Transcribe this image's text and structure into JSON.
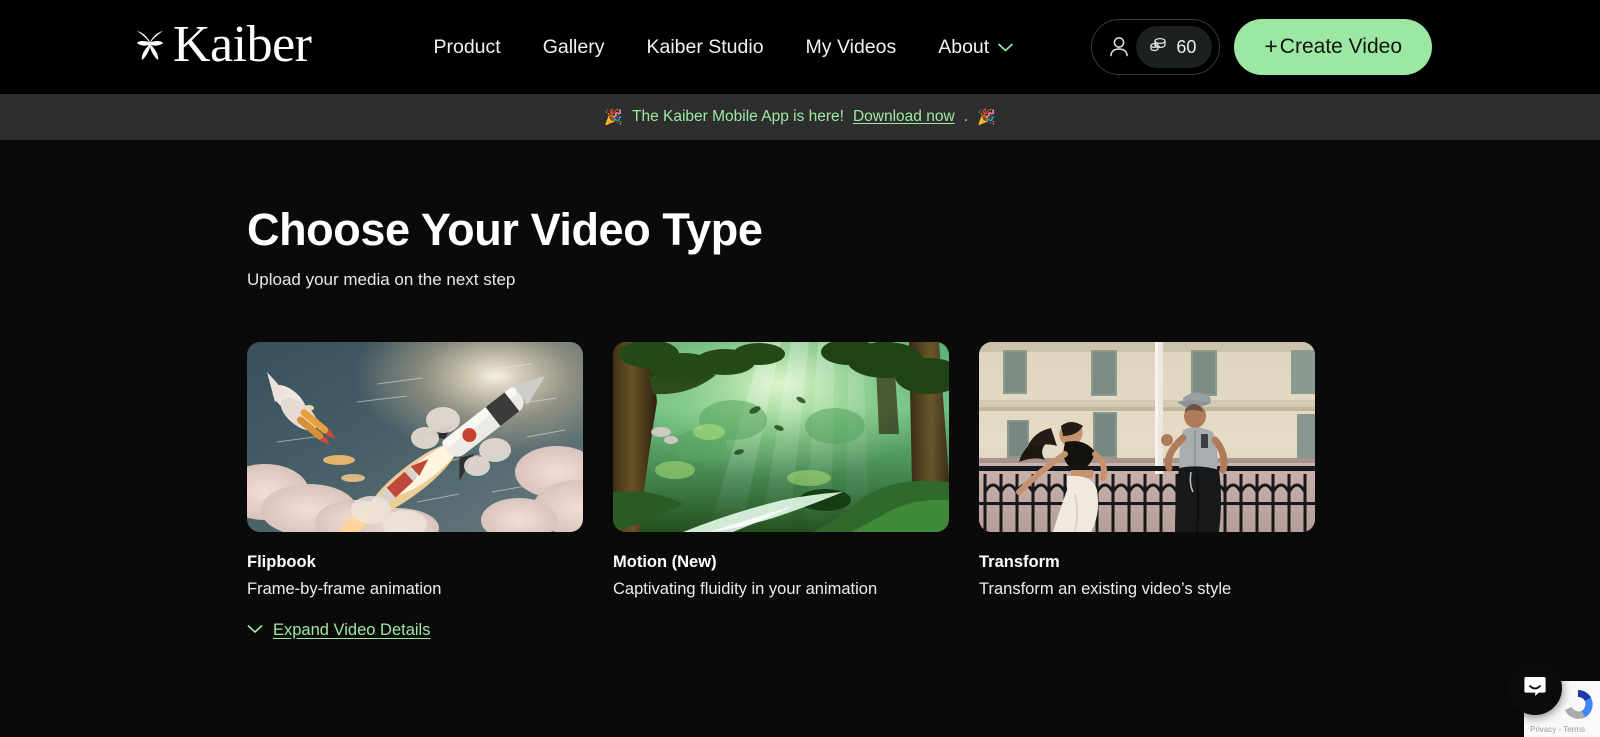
{
  "brand": {
    "name": "Kaiber",
    "logo_icon": "kaiber-pinwheel-icon",
    "accent_green": "#9ce8a2"
  },
  "header": {
    "nav": [
      {
        "label": "Product"
      },
      {
        "label": "Gallery"
      },
      {
        "label": "Kaiber Studio"
      },
      {
        "label": "My Videos"
      },
      {
        "label": "About",
        "has_chevron": true
      }
    ],
    "account": {
      "person_icon": "person-icon",
      "credits_icon": "coin-stack-icon",
      "credits": "60"
    },
    "create_button": {
      "plus": "+",
      "label": "Create Video"
    }
  },
  "banner": {
    "left_emoji": "🎉",
    "right_emoji": "🎉",
    "text": "The Kaiber Mobile App is here!",
    "link": "Download now",
    "period": "."
  },
  "main": {
    "title": "Choose Your Video Type",
    "subtitle": "Upload your media on the next step",
    "cards": [
      {
        "title": "Flipbook",
        "description": "Frame-by-frame animation",
        "thumb": "rockets-launching-illustration"
      },
      {
        "title": "Motion (New)",
        "description": "Captivating fluidity in your animation",
        "thumb": "green-forest-light-rays-illustration"
      },
      {
        "title": "Transform",
        "description": "Transform an existing video’s style",
        "thumb": "two-dancers-street-photo"
      }
    ],
    "expand": {
      "icon": "chevron-down-icon",
      "label": "Expand Video Details"
    }
  },
  "widgets": {
    "recaptcha": {
      "text": "Privacy - Terms",
      "icon": "recaptcha-icon"
    },
    "intercom": {
      "icon": "chat-bubble-icon"
    }
  }
}
